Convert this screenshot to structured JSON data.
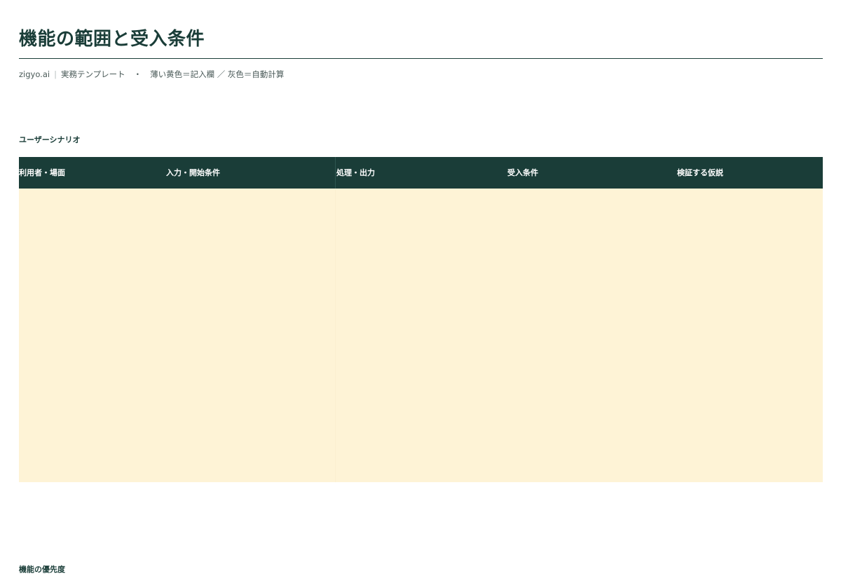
{
  "header": {
    "title": "機能の範囲と受入条件",
    "brand": "zigyo.ai",
    "template": "実務テンプレート",
    "bullet": "・",
    "legend": "薄い黄色＝記入欄 ／ 灰色＝自動計算"
  },
  "sections": {
    "scenario_label": "ユーザーシナリオ",
    "priority_label": "機能の優先度"
  },
  "scenario_table": {
    "columns": [
      "利用者・場面",
      "入力・開始条件",
      "処理・出力",
      "受入条件",
      "検証する仮説"
    ],
    "rows": [
      {
        "scene": "",
        "input": "",
        "process": "",
        "acceptance": "",
        "hypothesis": ""
      }
    ],
    "colors": {
      "header_bg": "#1a3d38",
      "header_text": "#ffffff",
      "input_bg": "#fef3d6"
    }
  }
}
